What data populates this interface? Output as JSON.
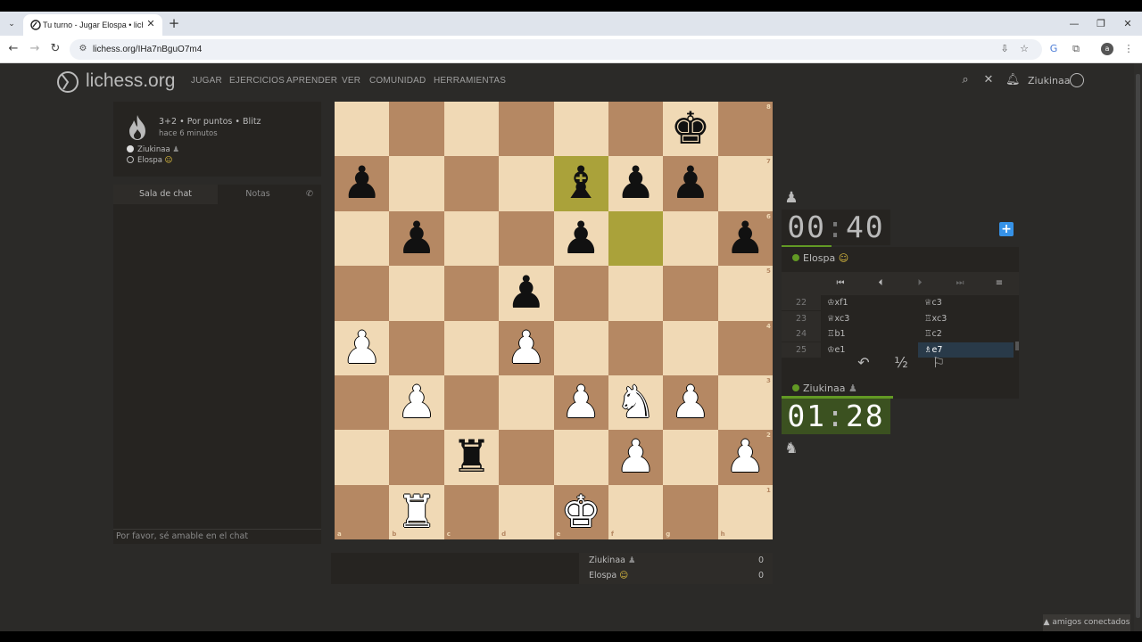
{
  "browser": {
    "tab_title": "Tu turno - Jugar Elospa • liches",
    "url": "lichess.org/IHa7nBguO7m4",
    "profile_initial": "a"
  },
  "site": {
    "logo_text": "lichess.org",
    "nav": [
      "JUGAR",
      "EJERCICIOS",
      "APRENDER",
      "VER",
      "COMUNIDAD",
      "HERRAMIENTAS"
    ],
    "username": "Ziukinaa",
    "friends_label": "▲ amigos conectados"
  },
  "game_info": {
    "meta": "3+2 • Por puntos • Blitz",
    "time": "hace 6 minutos",
    "white_player": "Ziukinaa",
    "black_player": "Elospa"
  },
  "chat": {
    "tab_chat": "Sala de chat",
    "tab_notes": "Notas",
    "placeholder": "Por favor, sé amable en el chat"
  },
  "board": {
    "files": [
      "a",
      "b",
      "c",
      "d",
      "e",
      "f",
      "g",
      "h"
    ],
    "ranks": [
      "8",
      "7",
      "6",
      "5",
      "4",
      "3",
      "2",
      "1"
    ],
    "highlight_squares": [
      "e7",
      "f6"
    ],
    "pieces": [
      {
        "sq": "g8",
        "color": "b",
        "type": "king",
        "glyph": "♚"
      },
      {
        "sq": "a7",
        "color": "b",
        "type": "pawn",
        "glyph": "♟"
      },
      {
        "sq": "e7",
        "color": "b",
        "type": "bishop",
        "glyph": "♝"
      },
      {
        "sq": "f7",
        "color": "b",
        "type": "pawn",
        "glyph": "♟"
      },
      {
        "sq": "g7",
        "color": "b",
        "type": "pawn",
        "glyph": "♟"
      },
      {
        "sq": "b6",
        "color": "b",
        "type": "pawn",
        "glyph": "♟"
      },
      {
        "sq": "e6",
        "color": "b",
        "type": "pawn",
        "glyph": "♟"
      },
      {
        "sq": "h6",
        "color": "b",
        "type": "pawn",
        "glyph": "♟"
      },
      {
        "sq": "d5",
        "color": "b",
        "type": "pawn",
        "glyph": "♟"
      },
      {
        "sq": "a4",
        "color": "w",
        "type": "pawn",
        "glyph": "♟"
      },
      {
        "sq": "d4",
        "color": "w",
        "type": "pawn",
        "glyph": "♟"
      },
      {
        "sq": "b3",
        "color": "w",
        "type": "pawn",
        "glyph": "♟"
      },
      {
        "sq": "e3",
        "color": "w",
        "type": "pawn",
        "glyph": "♟"
      },
      {
        "sq": "f3",
        "color": "w",
        "type": "knight",
        "glyph": "♞"
      },
      {
        "sq": "g3",
        "color": "w",
        "type": "pawn",
        "glyph": "♟"
      },
      {
        "sq": "c2",
        "color": "b",
        "type": "rook",
        "glyph": "♜"
      },
      {
        "sq": "f2",
        "color": "w",
        "type": "pawn",
        "glyph": "♟"
      },
      {
        "sq": "h2",
        "color": "w",
        "type": "pawn",
        "glyph": "♟"
      },
      {
        "sq": "b1",
        "color": "w",
        "type": "rook",
        "glyph": "♜"
      },
      {
        "sq": "e1",
        "color": "w",
        "type": "king",
        "glyph": "♚"
      }
    ]
  },
  "clocks": {
    "top": {
      "min": "00",
      "sec": "40",
      "player": "Elospa"
    },
    "bottom": {
      "min": "01",
      "sec": "28",
      "player": "Ziukinaa"
    }
  },
  "moves": [
    {
      "num": "22",
      "white": "♔xf1",
      "black": "♕c3"
    },
    {
      "num": "23",
      "white": "♕xc3",
      "black": "♖xc3"
    },
    {
      "num": "24",
      "white": "♖b1",
      "black": "♖c2"
    },
    {
      "num": "25",
      "white": "♔e1",
      "black": "♗e7",
      "active": true
    }
  ],
  "actions": {
    "takeback": "↶",
    "draw": "½",
    "resign": "⚐"
  },
  "score": {
    "rows": [
      {
        "name": "Ziukinaa",
        "points": "0"
      },
      {
        "name": "Elospa",
        "points": "0"
      }
    ]
  },
  "colors": {
    "light_square": "#f0d9b5",
    "dark_square": "#b58863",
    "last_move_dark": "#aaa23a",
    "last_move_light": "#cdd26a",
    "active_clock": "#3b5120",
    "online_dot": "#629924"
  }
}
